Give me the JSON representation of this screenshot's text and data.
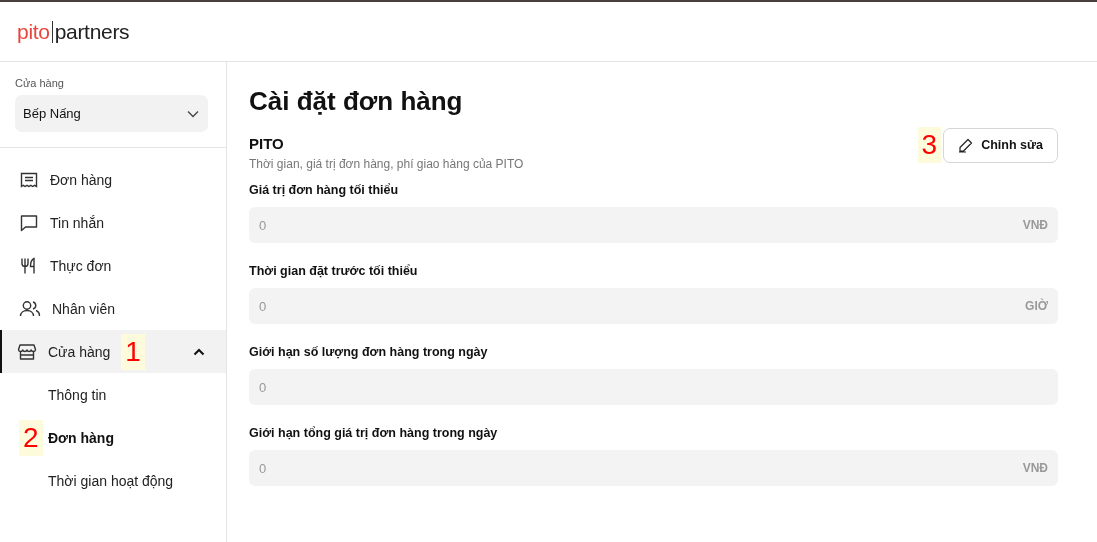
{
  "logo": {
    "brand": "pito",
    "suffix": "partners"
  },
  "store_select": {
    "label": "Cửa hàng",
    "value": "Bếp Nấng"
  },
  "nav": [
    {
      "kind": "receipt",
      "label": "Đơn hàng",
      "selected": false
    },
    {
      "kind": "chat",
      "label": "Tin nhắn",
      "selected": false
    },
    {
      "kind": "utensils",
      "label": "Thực đơn",
      "selected": false
    },
    {
      "kind": "people",
      "label": "Nhân viên",
      "selected": false
    },
    {
      "kind": "store",
      "label": "Cửa hàng",
      "selected": true,
      "expanded": true,
      "marker": "1",
      "children": [
        {
          "label": "Thông tin",
          "selected": false
        },
        {
          "label": "Đơn hàng",
          "selected": true,
          "marker": "2"
        },
        {
          "label": "Thời gian hoạt động",
          "selected": false
        }
      ]
    }
  ],
  "page": {
    "title": "Cài đặt đơn hàng",
    "section": {
      "title": "PITO",
      "subtitle": "Thời gian, giá trị đơn hàng, phí giao hàng của PITO",
      "edit_button": {
        "label": "Chỉnh sửa",
        "marker": "3"
      }
    },
    "fields": [
      {
        "label": "Giá trị đơn hàng tối thiểu",
        "placeholder": "0",
        "unit": "VNĐ"
      },
      {
        "label": "Thời gian đặt trước tối thiểu",
        "placeholder": "0",
        "unit": "GIỜ"
      },
      {
        "label": "Giới hạn số lượng đơn hàng trong ngày",
        "placeholder": "0"
      },
      {
        "label": "Giới hạn tổng giá trị đơn hàng trong ngày",
        "placeholder": "0",
        "unit": "VNĐ"
      }
    ]
  }
}
